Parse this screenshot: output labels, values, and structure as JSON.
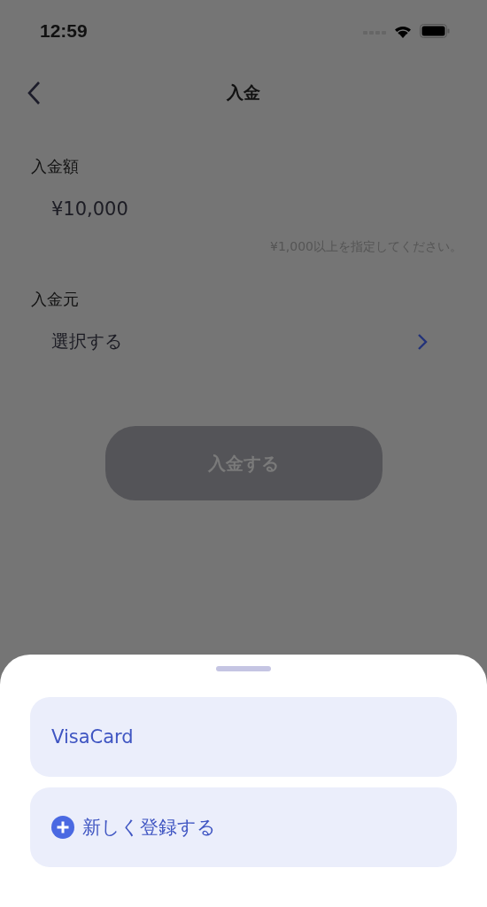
{
  "status_bar": {
    "time": "12:59"
  },
  "nav": {
    "title": "入金"
  },
  "amount": {
    "label": "入金額",
    "value": "¥10,000",
    "hint": "¥1,000以上を指定してください。"
  },
  "source": {
    "label": "入金元",
    "value": "選択する"
  },
  "submit": {
    "label": "入金する",
    "disabled": true
  },
  "sheet": {
    "options": [
      {
        "kind": "card",
        "label": "VisaCard"
      },
      {
        "kind": "add",
        "label": "新しく登録する"
      }
    ]
  }
}
